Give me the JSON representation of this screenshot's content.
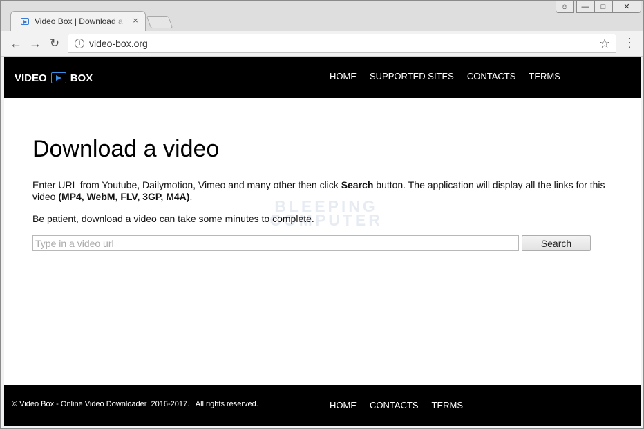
{
  "browser": {
    "tab_title": "Video Box | Download a video",
    "tab_close_glyph": "×",
    "url": "video-box.org",
    "controls": {
      "user_glyph": "👤",
      "min_glyph": "—",
      "max_glyph": "□",
      "close_glyph": "✕"
    },
    "nav_glyphs": {
      "back": "←",
      "forward": "→",
      "reload": "↻",
      "info": "i",
      "star": "☆",
      "menu": "⋮"
    }
  },
  "site": {
    "logo_left": "VIDEO",
    "logo_right": "BOX",
    "nav": [
      "HOME",
      "SUPPORTED SITES",
      "CONTACTS",
      "TERMS"
    ],
    "title": "Download a video",
    "intro_1": "Enter URL from Youtube, Dailymotion, Vimeo and many other then click ",
    "intro_bold": "Search",
    "intro_2": " button. The application will display all the links for this video ",
    "intro_formats": "(MP4, WebM, FLV, 3GP, M4A)",
    "intro_end": ".",
    "patience": "Be patient, download a video can take some minutes to complete.",
    "input_placeholder": "Type in a video url",
    "search_label": "Search",
    "watermark_line1": "BLEEPING",
    "watermark_line2": "COMPUTER",
    "footer_copyright": "© Video Box - Online Video Downloader  2016-2017.   All rights reserved.",
    "footer_nav": [
      "HOME",
      "CONTACTS",
      "TERMS"
    ]
  },
  "colors": {
    "accent": "#3a8ee6",
    "header_bg": "#000000"
  }
}
